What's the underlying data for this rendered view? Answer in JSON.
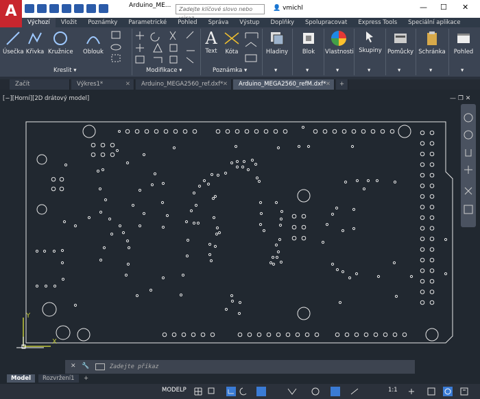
{
  "titlebar": {
    "title": "Arduino_ME...",
    "search_placeholder": "Zadejte klíčové slovo nebo výraz.",
    "user": "vmichl"
  },
  "ribbon_tabs": [
    "Výchozí",
    "Vložit",
    "Poznámky",
    "Parametrické",
    "Pohled",
    "Správa",
    "Výstup",
    "Doplňky",
    "Spolupracovat",
    "Express Tools",
    "Speciální aplikace"
  ],
  "tools": {
    "line": "Úsečka",
    "polyline": "Křivka",
    "circle": "Kružnice",
    "arc": "Oblouk",
    "text": "Text",
    "dimension": "Kóta",
    "layers": "Hladiny",
    "block": "Blok",
    "properties": "Vlastnosti",
    "groups": "Skupiny",
    "utilities": "Pomůcky",
    "clipboard": "Schránka",
    "view": "Pohled"
  },
  "groups": {
    "draw": "Kreslit",
    "modify": "Modifikace",
    "annotation": "Poznámka"
  },
  "doctabs": [
    "Začít",
    "Výkres1*",
    "Arduino_MEGA2560_ref.dxf*",
    "Arduino_MEGA2560_refM.dxf*"
  ],
  "viewport_label": "[−][Horní][2D drátový model]",
  "command_placeholder": "Zadejte příkaz",
  "layout_tabs": [
    "Model",
    "Rozvržení1"
  ],
  "status": {
    "model": "MODELP",
    "scale": "1:1"
  },
  "axis": {
    "y": "Y",
    "x": "X"
  },
  "colors": {
    "accent": "#c8262e",
    "ribbon": "#3b4453",
    "canvas": "#212830"
  }
}
